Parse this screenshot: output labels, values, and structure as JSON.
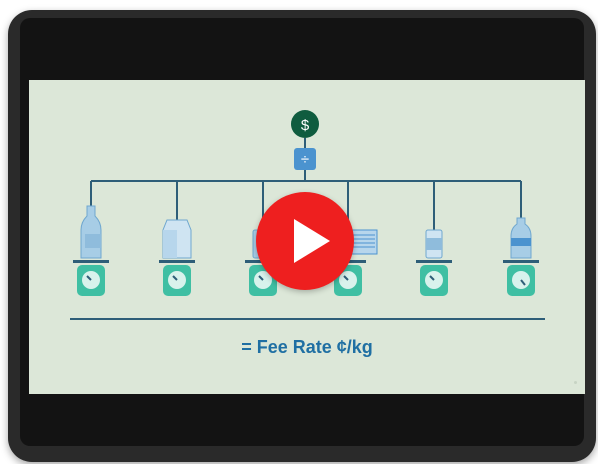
{
  "video": {
    "caption": "= Fee Rate ¢/kg",
    "top_symbol": "$",
    "divide_symbol": "÷",
    "play_icon": "play-icon",
    "colors": {
      "background": "#dce7d8",
      "line": "#2e5e78",
      "scale": "#3fbfa3",
      "accent_blue": "#4b93cf",
      "dollar_circle": "#0f5c3f",
      "caption": "#1f6fa3",
      "play_red": "#ee1f1f"
    },
    "items": [
      {
        "name": "glass-bottle"
      },
      {
        "name": "milk-carton"
      },
      {
        "name": "jar"
      },
      {
        "name": "paper-stack"
      },
      {
        "name": "can"
      },
      {
        "name": "plastic-bottle"
      }
    ]
  }
}
